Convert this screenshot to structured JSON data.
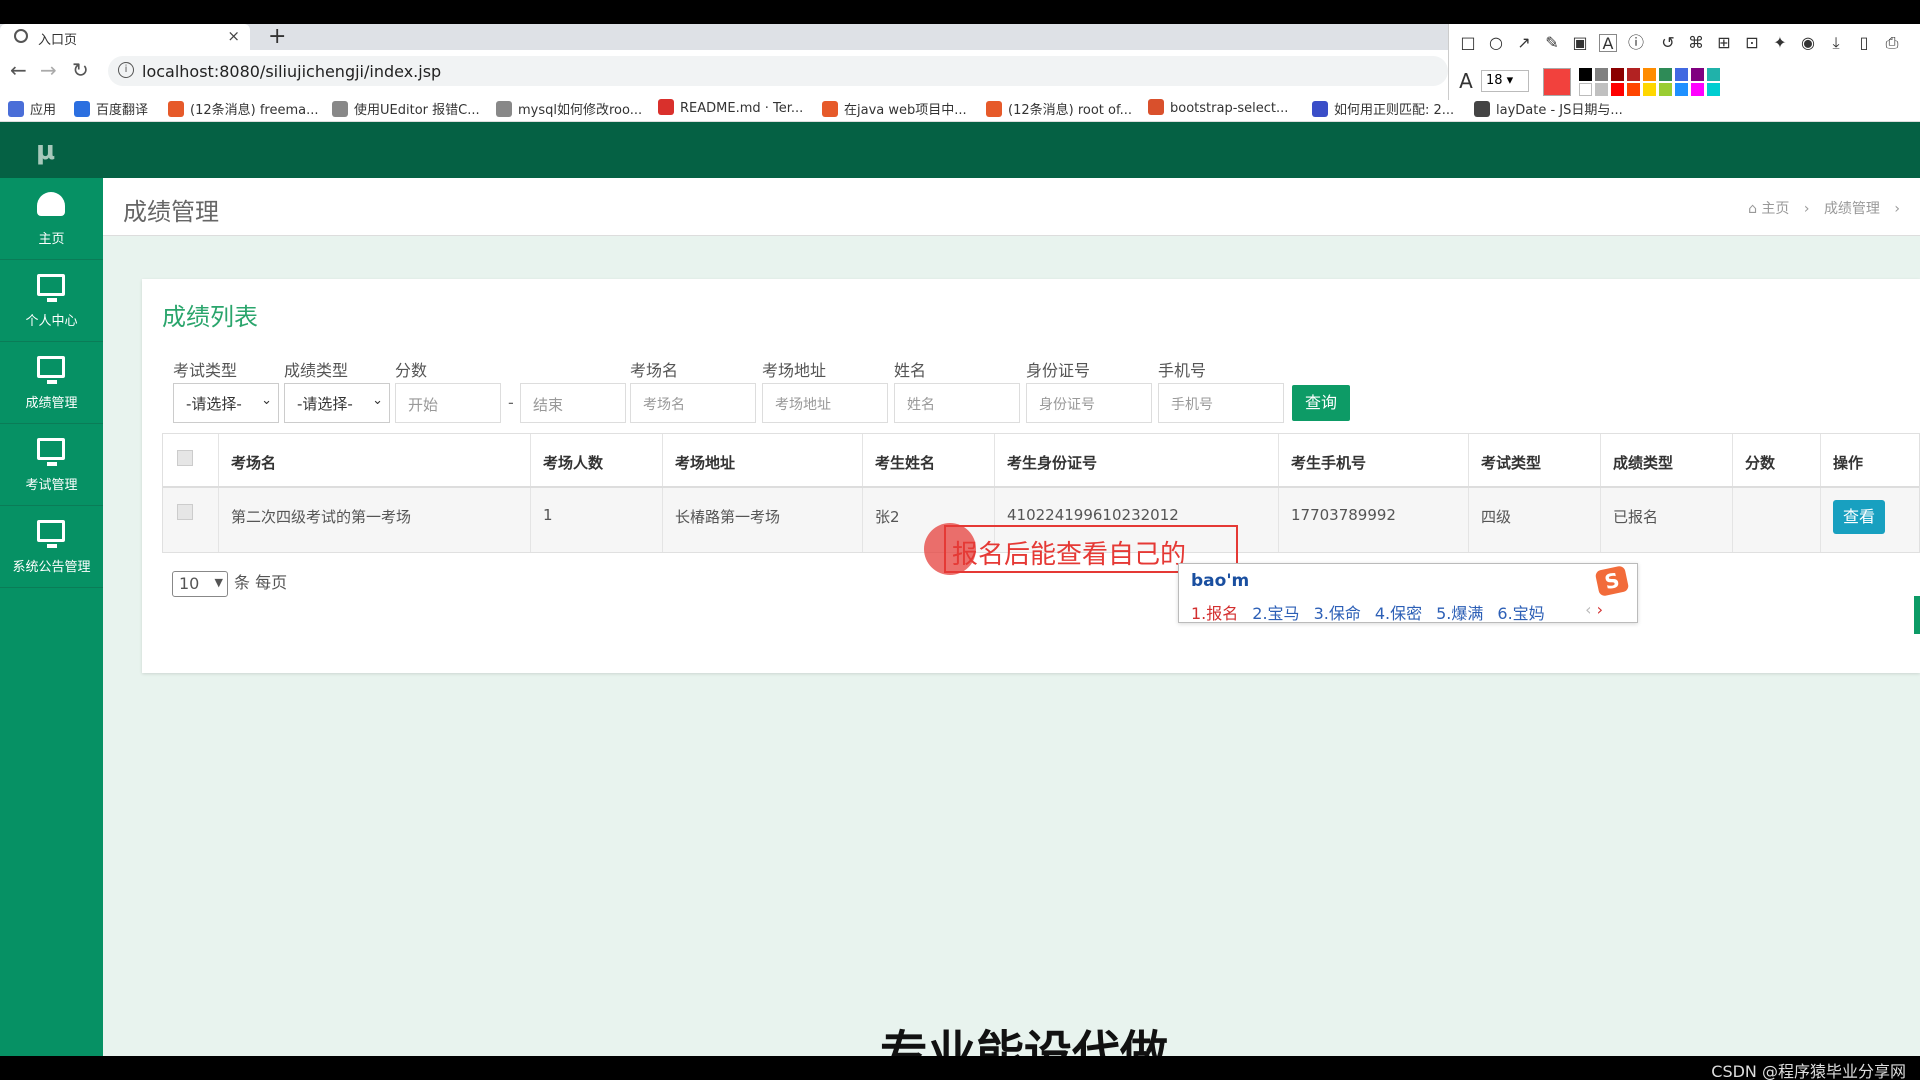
{
  "browser": {
    "tab_title": "入口页",
    "tab_close": "×",
    "new_tab": "+",
    "url": "localhost:8080/siliujichengji/index.jsp",
    "bookmarks": [
      {
        "label": "应用",
        "color": "#4a6ed8"
      },
      {
        "label": "百度翻译",
        "color": "#2b6fe0"
      },
      {
        "label": "(12条消息) freema...",
        "color": "#e65a2a"
      },
      {
        "label": "使用UEditor 报错C...",
        "color": "#555555"
      },
      {
        "label": "mysql如何修改roo...",
        "color": "#555555"
      },
      {
        "label": "README.md · Ter...",
        "color": "#d9302c"
      },
      {
        "label": "在java web项目中...",
        "color": "#e65a2a"
      },
      {
        "label": "(12条消息) root of...",
        "color": "#e65a2a"
      },
      {
        "label": "bootstrap-select...",
        "color": "#d9502c"
      },
      {
        "label": "如何用正则匹配: 2...",
        "color": "#3a4ec8"
      },
      {
        "label": "layDate - JS日期与...",
        "color": "#444444"
      }
    ]
  },
  "annotation_tool": {
    "font_size": "18",
    "current_color": "#f2413d",
    "palette": [
      "#000000",
      "#808080",
      "#8b0000",
      "#b22222",
      "#ff8c00",
      "#2e8b57",
      "#4169e1",
      "#800080",
      "#20b2aa",
      "#ffffff",
      "#c0c0c0",
      "#ff0000",
      "#ff4500",
      "#ffd700",
      "#9acd32",
      "#1e90ff",
      "#ff00ff",
      "#00ced1"
    ]
  },
  "app": {
    "logo": "μ",
    "sidebar": [
      {
        "label": "主页"
      },
      {
        "label": "个人中心"
      },
      {
        "label": "成绩管理"
      },
      {
        "label": "考试管理"
      },
      {
        "label": "系统公告管理"
      }
    ],
    "page_title": "成绩管理",
    "breadcrumb": {
      "home": "主页",
      "current": "成绩管理"
    },
    "panel_title": "成绩列表",
    "filters": {
      "exam_type_label": "考试类型",
      "exam_type_value": "-请选择-",
      "grade_type_label": "成绩类型",
      "grade_type_value": "-请选择-",
      "score_label": "分数",
      "score_start": "开始",
      "score_dash": "-",
      "score_end": "结束",
      "room_name_label": "考场名",
      "room_name_placeholder": "考场名",
      "room_addr_label": "考场地址",
      "room_addr_placeholder": "考场地址",
      "name_label": "姓名",
      "name_placeholder": "姓名",
      "id_label": "身份证号",
      "id_placeholder": "身份证号",
      "phone_label": "手机号",
      "phone_placeholder": "手机号",
      "query_button": "查询"
    },
    "table": {
      "headers": [
        "考场名",
        "考场人数",
        "考场地址",
        "考生姓名",
        "考生身份证号",
        "考生手机号",
        "考试类型",
        "成绩类型",
        "分数",
        "操作"
      ],
      "rows": [
        {
          "cells": [
            "第二次四级考试的第一考场",
            "1",
            "长椿路第一考场",
            "张2",
            "410224199610232012",
            "17703789992",
            "四级",
            "已报名",
            ""
          ],
          "action": "查看"
        }
      ]
    },
    "pager": {
      "page_size": "10",
      "suffix": "条 每页"
    }
  },
  "overlay": {
    "annotation_text": "报名后能查看自己的",
    "ime_input": "bao'm",
    "ime_logo": "S",
    "ime_candidates": [
      "1.报名",
      "2.宝马",
      "3.保命",
      "4.保密",
      "5.爆满",
      "6.宝妈"
    ],
    "ime_prev": "‹",
    "ime_next": "›",
    "caption_fragment": "专业能设代做",
    "watermark": "CSDN @程序猿毕业分享网"
  }
}
